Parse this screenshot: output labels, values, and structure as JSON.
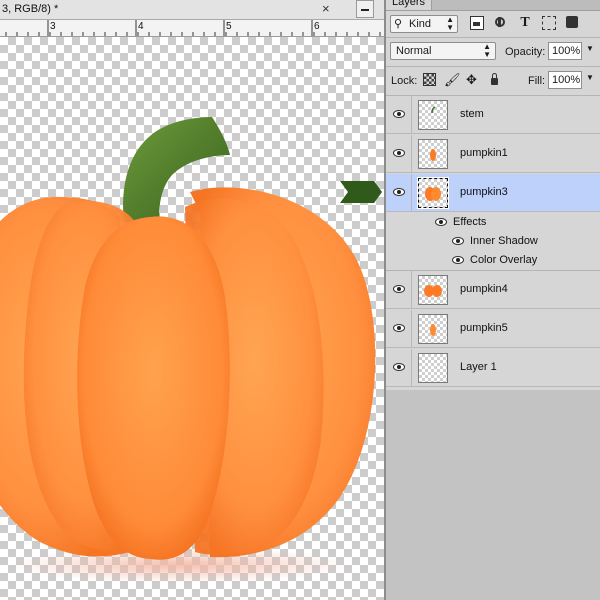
{
  "document": {
    "tab_title": "3, RGB/8) *",
    "close_glyph": "×",
    "ruler_labels": [
      "3",
      "4",
      "5",
      "6"
    ]
  },
  "layers_panel": {
    "tab_label": "Layers",
    "filter": {
      "kind_icon": "search-icon",
      "kind_label": "Kind",
      "icons": [
        "pixel-filter-icon",
        "adjustment-filter-icon",
        "type-filter-icon",
        "shape-filter-icon",
        "smart-object-filter-icon"
      ],
      "type_glyph": "T"
    },
    "blend_mode": "Normal",
    "opacity_label": "Opacity:",
    "opacity_value": "100%",
    "lock_label": "Lock:",
    "lock_icons": [
      "lock-transparent-pixels-icon",
      "lock-image-pixels-icon",
      "lock-position-icon",
      "lock-all-icon"
    ],
    "fill_label": "Fill:",
    "fill_value": "100%",
    "layers": [
      {
        "name": "stem",
        "selected": false,
        "thumb": "stem"
      },
      {
        "name": "pumpkin1",
        "selected": false,
        "thumb": "pumpkin1"
      },
      {
        "name": "pumpkin3",
        "selected": true,
        "thumb": "pumpkin3"
      },
      {
        "name": "pumpkin4",
        "selected": false,
        "thumb": "pumpkin4"
      },
      {
        "name": "pumpkin5",
        "selected": false,
        "thumb": "pumpkin5"
      },
      {
        "name": "Layer 1",
        "selected": false,
        "thumb": "empty"
      }
    ],
    "effects": {
      "label": "Effects",
      "items": [
        "Inner Shadow",
        "Color Overlay"
      ]
    }
  },
  "colors": {
    "pumpkin_orange": "#ff8a30",
    "pumpkin_dark": "#f56f1c",
    "stem_green": "#4a7a2a",
    "arrow_green": "#2f5a1a",
    "selection_blue": "#bed1fb"
  }
}
